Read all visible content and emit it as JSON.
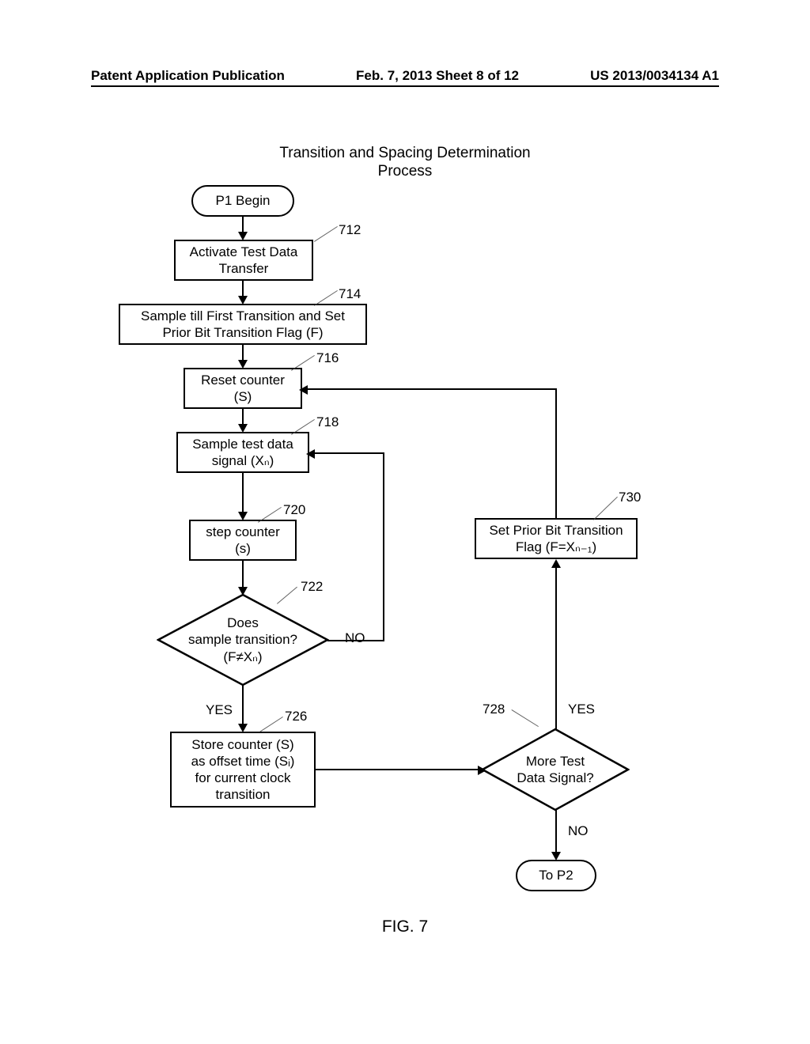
{
  "header": {
    "left": "Patent Application Publication",
    "center": "Feb. 7, 2013  Sheet 8 of 12",
    "right": "US 2013/0034134 A1"
  },
  "title1": "Transition and Spacing Determination",
  "title2": "Process",
  "nodes": {
    "begin": "P1 Begin",
    "n712": "Activate Test Data\nTransfer",
    "n714": "Sample till First Transition and Set\nPrior Bit Transition Flag (F)",
    "n716": "Reset counter\n(S)",
    "n718": "Sample test data\nsignal (Xₙ)",
    "n720": "step counter\n(s)",
    "n722": "Does\nsample transition?\n(F≠Xₙ)",
    "n726": "Store counter (S)\nas offset time (Sᵢ)\nfor current clock\ntransition",
    "n728": "More Test\nData Signal?",
    "n730": "Set Prior Bit Transition\nFlag (F=Xₙ₋₁)",
    "end": "To P2"
  },
  "refs": {
    "r712": "712",
    "r714": "714",
    "r716": "716",
    "r718": "718",
    "r720": "720",
    "r722": "722",
    "r726": "726",
    "r728": "728",
    "r730": "730"
  },
  "labels": {
    "yes": "YES",
    "no": "NO",
    "yes2": "YES",
    "no2": "NO"
  },
  "figure": "FIG. 7",
  "chart_data": {
    "type": "flowchart",
    "title": "Transition and Spacing Determination Process",
    "nodes": [
      {
        "id": "begin",
        "type": "terminator",
        "label": "P1 Begin"
      },
      {
        "id": "712",
        "type": "process",
        "label": "Activate Test Data Transfer"
      },
      {
        "id": "714",
        "type": "process",
        "label": "Sample till First Transition and Set Prior Bit Transition Flag (F)"
      },
      {
        "id": "716",
        "type": "process",
        "label": "Reset counter (S)"
      },
      {
        "id": "718",
        "type": "process",
        "label": "Sample test data signal (X_n)"
      },
      {
        "id": "720",
        "type": "process",
        "label": "step counter (s)"
      },
      {
        "id": "722",
        "type": "decision",
        "label": "Does sample transition? (F != X_n)"
      },
      {
        "id": "726",
        "type": "process",
        "label": "Store counter (S) as offset time (S_i) for current clock transition"
      },
      {
        "id": "728",
        "type": "decision",
        "label": "More Test Data Signal?"
      },
      {
        "id": "730",
        "type": "process",
        "label": "Set Prior Bit Transition Flag (F = X_{n-1})"
      },
      {
        "id": "end",
        "type": "terminator",
        "label": "To P2"
      }
    ],
    "edges": [
      {
        "from": "begin",
        "to": "712"
      },
      {
        "from": "712",
        "to": "714"
      },
      {
        "from": "714",
        "to": "716"
      },
      {
        "from": "716",
        "to": "718"
      },
      {
        "from": "718",
        "to": "720"
      },
      {
        "from": "720",
        "to": "722"
      },
      {
        "from": "722",
        "to": "718",
        "label": "NO"
      },
      {
        "from": "722",
        "to": "726",
        "label": "YES"
      },
      {
        "from": "726",
        "to": "728"
      },
      {
        "from": "728",
        "to": "730",
        "label": "YES"
      },
      {
        "from": "730",
        "to": "716"
      },
      {
        "from": "728",
        "to": "end",
        "label": "NO"
      }
    ]
  }
}
